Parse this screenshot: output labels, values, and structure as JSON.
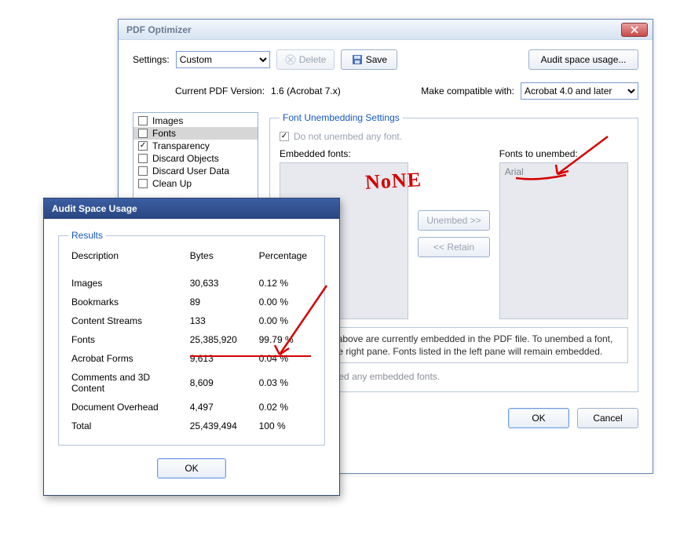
{
  "pdfopt": {
    "title": "PDF Optimizer",
    "settings_label": "Settings:",
    "settings_value": "Custom",
    "delete_label": "Delete",
    "save_label": "Save",
    "audit_btn": "Audit space usage...",
    "current_version_label": "Current PDF Version:",
    "current_version_value": "1.6 (Acrobat 7.x)",
    "compat_label": "Make compatible with:",
    "compat_value": "Acrobat 4.0 and later",
    "categories": [
      {
        "label": "Images",
        "checked": false,
        "selected": false
      },
      {
        "label": "Fonts",
        "checked": false,
        "selected": true
      },
      {
        "label": "Transparency",
        "checked": true,
        "selected": false
      },
      {
        "label": "Discard Objects",
        "checked": false,
        "selected": false
      },
      {
        "label": "Discard User Data",
        "checked": false,
        "selected": false
      },
      {
        "label": "Clean Up",
        "checked": false,
        "selected": false
      }
    ],
    "fonts_panel": {
      "legend": "Font Unembedding Settings",
      "dont_unembed": "Do not unembed any font.",
      "embedded_label": "Embedded fonts:",
      "tounembed_label": "Fonts to unembed:",
      "unembed_btn": "Unembed >>",
      "retain_btn": "<< Retain",
      "embedded_items": [],
      "tounembed_items": [
        "Arial"
      ],
      "help_box": "Fonts listed above are currently embedded in the PDF file. To unembed a font, move it to the right pane. Fonts listed in the left pane will remain embedded.",
      "help_disabled": "Do not unembed any embedded fonts."
    },
    "ok": "OK",
    "cancel": "Cancel"
  },
  "audit": {
    "title": "Audit Space Usage",
    "results_legend": "Results",
    "cols": {
      "desc": "Description",
      "bytes": "Bytes",
      "pct": "Percentage"
    },
    "rows": [
      {
        "desc": "Images",
        "bytes": "30,633",
        "pct": "0.12 %"
      },
      {
        "desc": "Bookmarks",
        "bytes": "89",
        "pct": "0.00 %"
      },
      {
        "desc": "Content Streams",
        "bytes": "133",
        "pct": "0.00 %"
      },
      {
        "desc": "Fonts",
        "bytes": "25,385,920",
        "pct": "99.79 %"
      },
      {
        "desc": "Acrobat Forms",
        "bytes": "9,613",
        "pct": "0.04 %"
      },
      {
        "desc": "Comments and 3D Content",
        "bytes": "8,609",
        "pct": "0.03 %"
      },
      {
        "desc": "Document Overhead",
        "bytes": "4,497",
        "pct": "0.02 %"
      },
      {
        "desc": "Total",
        "bytes": "25,439,494",
        "pct": "100 %"
      }
    ],
    "ok": "OK"
  },
  "annotations": {
    "none_text": "NoNE"
  }
}
